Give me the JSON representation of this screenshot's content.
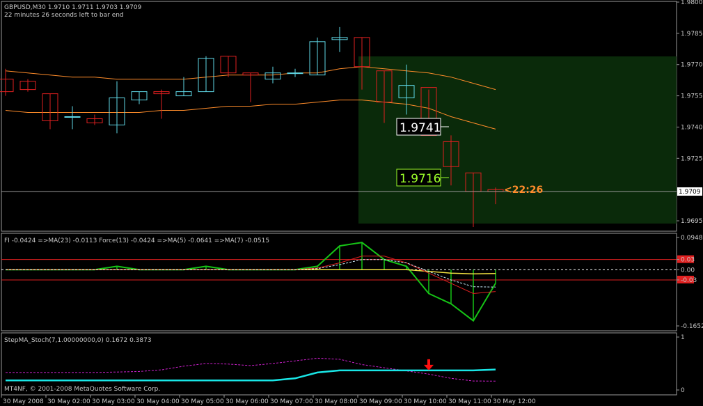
{
  "main": {
    "header": "GBPUSD,M30  1.9710 1.9711 1.9703 1.9709",
    "subheader": "22 minutes 26 seconds left to bar end",
    "price_labels": [
      "1.9800",
      "1.9785",
      "1.9770",
      "1.9755",
      "1.9740",
      "1.9725",
      "1.9709",
      "1.9695"
    ],
    "current_price_label": "1.9709",
    "box_label_1": "1.9741",
    "box_label_2": "1.9716",
    "timer_label": "<22:26"
  },
  "force": {
    "header": "FI -0.0424 =>MA(23) -0.0113 Force(13) -0.0424 =>MA(5) -0.0641 =>MA(7) -0.0515",
    "labels": [
      "0.0948",
      "0.03",
      "0.00",
      "-0.03",
      "-0.1652"
    ]
  },
  "stoch": {
    "header": "StepMA_Stoch(7,1.00000000,0) 0.1672 0.3873",
    "labels": [
      "1",
      "0"
    ],
    "copyright": "MT4NF, © 2001-2008 MetaQuotes Software Corp."
  },
  "time_labels": [
    "30 May 2008",
    "30 May 02:00",
    "30 May 03:00",
    "30 May 04:00",
    "30 May 05:00",
    "30 May 06:00",
    "30 May 07:00",
    "30 May 08:00",
    "30 May 09:00",
    "30 May 10:00",
    "30 May 11:00",
    "30 May 12:00"
  ],
  "colors": {
    "up": "#5fd7e6",
    "down": "#e02020",
    "ma": "#ff8c2a",
    "box": "#0a2a0a",
    "force": "#16c416",
    "stoch": "#19e6e6"
  },
  "chart_data": {
    "type": "candlestick",
    "symbol": "GBPUSD",
    "timeframe": "M30",
    "ylim": [
      1.969,
      1.98
    ],
    "candles": [
      {
        "o": 1.9763,
        "h": 1.9768,
        "l": 1.9755,
        "c": 1.9757
      },
      {
        "o": 1.9762,
        "h": 1.9763,
        "l": 1.9757,
        "c": 1.9758
      },
      {
        "o": 1.9756,
        "h": 1.9756,
        "l": 1.9739,
        "c": 1.9743
      },
      {
        "o": 1.9745,
        "h": 1.975,
        "l": 1.9739,
        "c": 1.9745
      },
      {
        "o": 1.9744,
        "h": 1.9746,
        "l": 1.9741,
        "c": 1.9742
      },
      {
        "o": 1.9741,
        "h": 1.9762,
        "l": 1.9737,
        "c": 1.9754
      },
      {
        "o": 1.9753,
        "h": 1.9757,
        "l": 1.9751,
        "c": 1.9757
      },
      {
        "o": 1.9757,
        "h": 1.9758,
        "l": 1.9744,
        "c": 1.9756
      },
      {
        "o": 1.9755,
        "h": 1.9764,
        "l": 1.9755,
        "c": 1.9757
      },
      {
        "o": 1.9757,
        "h": 1.9774,
        "l": 1.9757,
        "c": 1.9773
      },
      {
        "o": 1.9774,
        "h": 1.9774,
        "l": 1.9764,
        "c": 1.9766
      },
      {
        "o": 1.9766,
        "h": 1.9766,
        "l": 1.9752,
        "c": 1.9765
      },
      {
        "o": 1.9763,
        "h": 1.9769,
        "l": 1.9761,
        "c": 1.9766
      },
      {
        "o": 1.9766,
        "h": 1.9768,
        "l": 1.9764,
        "c": 1.9766
      },
      {
        "o": 1.9765,
        "h": 1.9783,
        "l": 1.9765,
        "c": 1.9781
      },
      {
        "o": 1.9782,
        "h": 1.9788,
        "l": 1.9776,
        "c": 1.9783
      },
      {
        "o": 1.9783,
        "h": 1.9783,
        "l": 1.9758,
        "c": 1.9769
      },
      {
        "o": 1.9767,
        "h": 1.9767,
        "l": 1.9742,
        "c": 1.9752
      },
      {
        "o": 1.9754,
        "h": 1.977,
        "l": 1.9746,
        "c": 1.976
      },
      {
        "o": 1.9759,
        "h": 1.9758,
        "l": 1.9741,
        "c": 1.9736
      },
      {
        "o": 1.9733,
        "h": 1.9736,
        "l": 1.9712,
        "c": 1.9721
      },
      {
        "o": 1.9718,
        "h": 1.9718,
        "l": 1.9692,
        "c": 1.9709
      },
      {
        "o": 1.971,
        "h": 1.9711,
        "l": 1.9703,
        "c": 1.9709
      }
    ],
    "ma_upper": [
      1.9767,
      1.9766,
      1.9765,
      1.9764,
      1.9764,
      1.9763,
      1.9763,
      1.9763,
      1.9763,
      1.9764,
      1.9765,
      1.9765,
      1.9765,
      1.9766,
      1.9766,
      1.9768,
      1.9769,
      1.9768,
      1.9767,
      1.9766,
      1.9764,
      1.9761,
      1.9758
    ],
    "ma_lower": [
      1.9748,
      1.9747,
      1.9747,
      1.9747,
      1.9747,
      1.9747,
      1.9747,
      1.9748,
      1.9748,
      1.9749,
      1.975,
      1.975,
      1.9751,
      1.9751,
      1.9752,
      1.9753,
      1.9753,
      1.9752,
      1.9751,
      1.9749,
      1.9745,
      1.9742,
      1.9739
    ],
    "current_price": 1.9709,
    "levels": [
      1.9741,
      1.9716
    ],
    "force_index": {
      "ylim": [
        -0.1652,
        0.0948
      ],
      "levels": [
        0.03,
        0.0,
        -0.03
      ],
      "force13": [
        0.0,
        0.0,
        0.0,
        0.0,
        0.0,
        0.01,
        0.0,
        0.0,
        0.0,
        0.01,
        0.0,
        0.0,
        0.0,
        0.0,
        0.01,
        0.07,
        0.08,
        0.03,
        0.01,
        -0.07,
        -0.1,
        -0.15,
        -0.04
      ],
      "ma23": [
        0.0,
        0.0,
        0.0,
        0.0,
        0.0,
        0.0,
        0.0,
        0.0,
        0.0,
        0.0,
        0.0,
        0.0,
        0.0,
        0.0,
        0.0,
        0.0,
        0.0,
        0.0,
        0.0,
        -0.005,
        -0.01,
        -0.012,
        -0.011
      ],
      "ma5": [
        0.0,
        0.0,
        0.0,
        0.0,
        0.0,
        0.0,
        0.0,
        0.0,
        0.0,
        0.0,
        0.0,
        0.0,
        0.0,
        0.0,
        0.005,
        0.02,
        0.04,
        0.04,
        0.02,
        -0.01,
        -0.04,
        -0.07,
        -0.064
      ],
      "ma7": [
        0.0,
        0.0,
        0.0,
        0.0,
        0.0,
        0.0,
        0.0,
        0.0,
        0.0,
        0.0,
        0.0,
        0.0,
        0.0,
        0.0,
        0.003,
        0.015,
        0.03,
        0.03,
        0.02,
        -0.005,
        -0.03,
        -0.05,
        -0.051
      ]
    },
    "stoch": {
      "ylim": [
        0,
        1
      ],
      "step_ma": [
        0.18,
        0.18,
        0.18,
        0.18,
        0.18,
        0.18,
        0.18,
        0.18,
        0.18,
        0.18,
        0.18,
        0.18,
        0.18,
        0.22,
        0.33,
        0.37,
        0.37,
        0.37,
        0.37,
        0.37,
        0.37,
        0.37,
        0.3873
      ],
      "stoch": [
        0.33,
        0.33,
        0.33,
        0.33,
        0.33,
        0.34,
        0.35,
        0.38,
        0.45,
        0.5,
        0.49,
        0.46,
        0.5,
        0.55,
        0.6,
        0.58,
        0.48,
        0.42,
        0.36,
        0.3,
        0.22,
        0.17,
        0.1672
      ],
      "signal_index": 19
    }
  }
}
